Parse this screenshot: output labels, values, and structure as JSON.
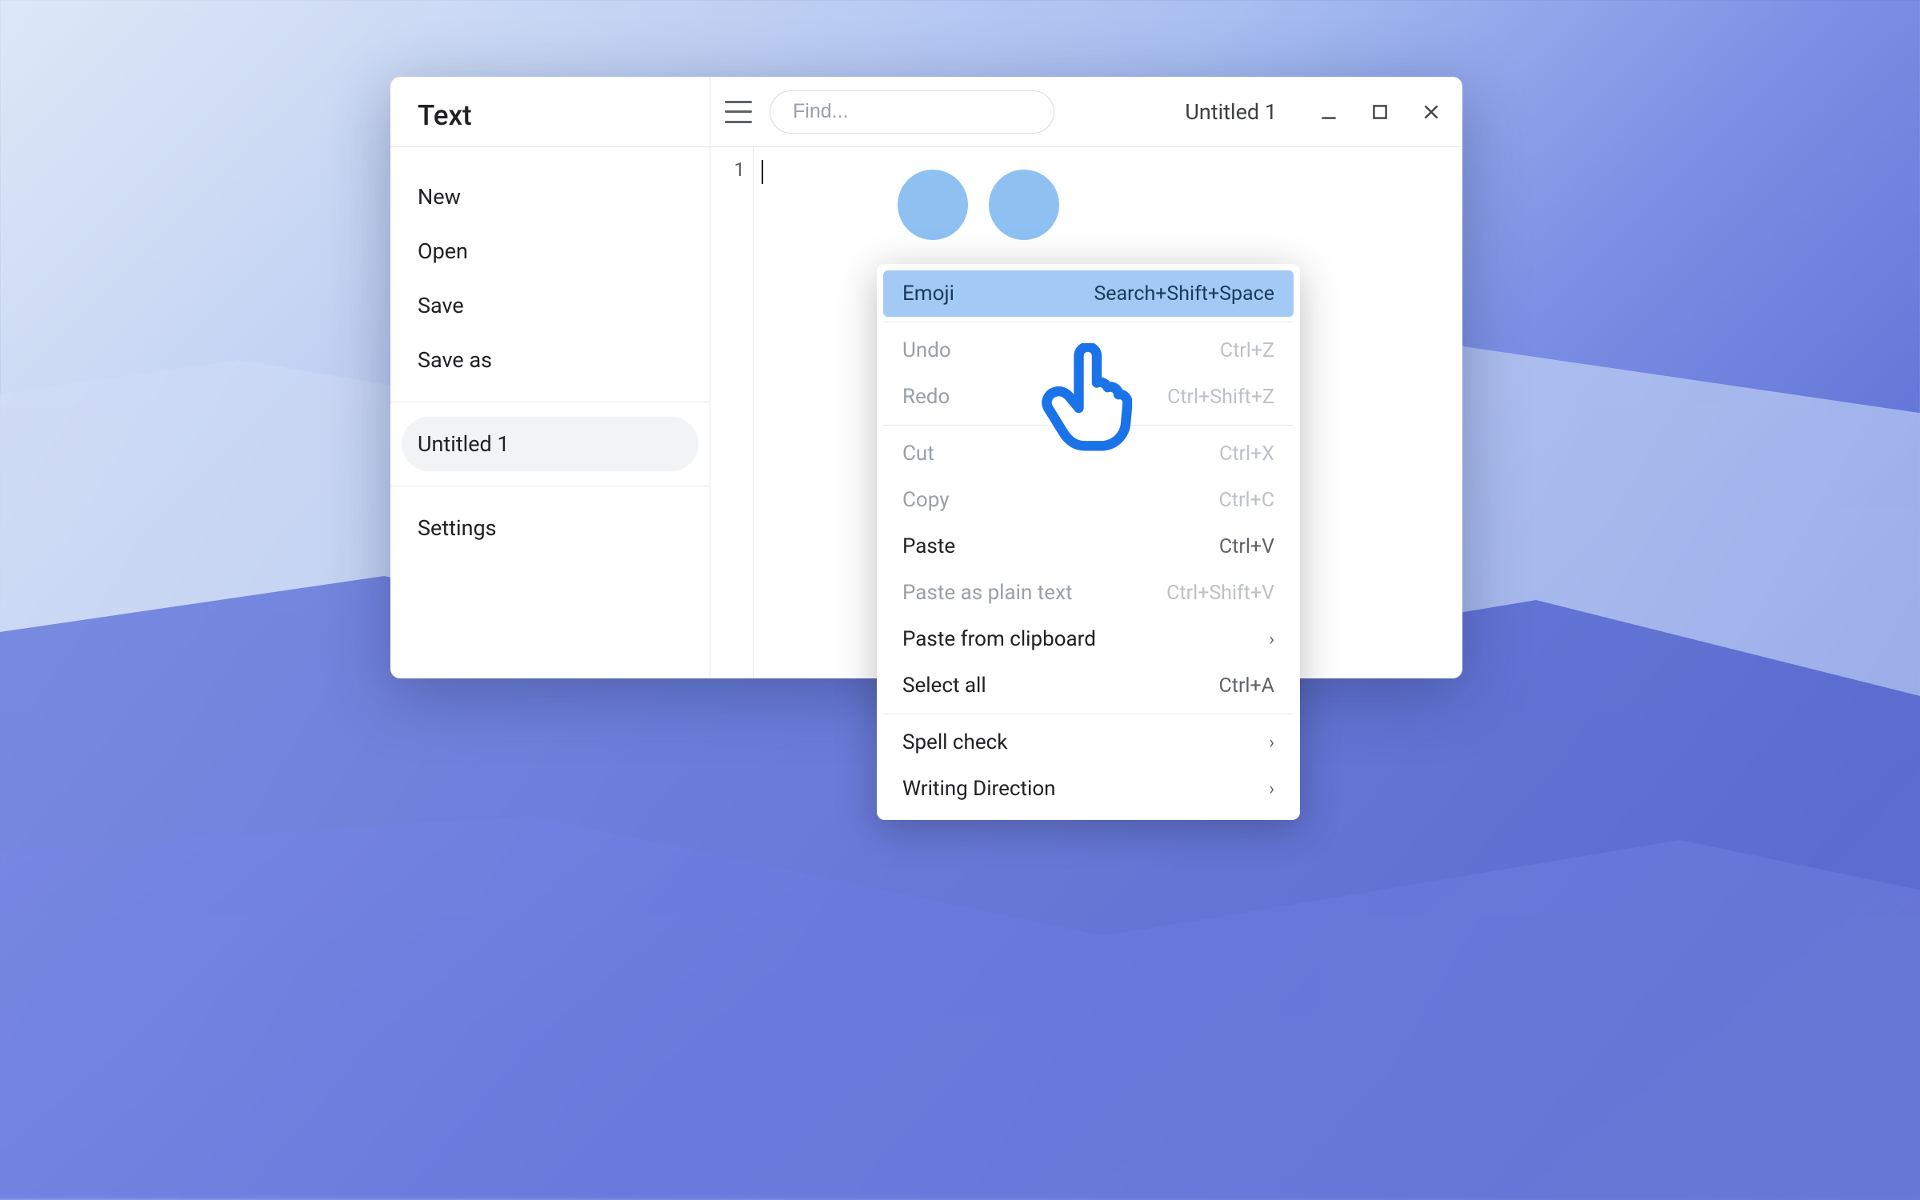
{
  "app": {
    "title": "Text"
  },
  "sidebar": {
    "items": [
      {
        "label": "New"
      },
      {
        "label": "Open"
      },
      {
        "label": "Save"
      },
      {
        "label": "Save as"
      }
    ],
    "activeDoc": "Untitled 1",
    "settings": "Settings"
  },
  "toolbar": {
    "search_placeholder": "Find...",
    "doc_name": "Untitled 1"
  },
  "editor": {
    "line_number": "1"
  },
  "context_menu": {
    "items": [
      {
        "label": "Emoji",
        "shortcut": "Search+Shift+Space",
        "state": "highlight",
        "arrow": false
      },
      {
        "sep": true
      },
      {
        "label": "Undo",
        "shortcut": "Ctrl+Z",
        "state": "disabled",
        "arrow": false
      },
      {
        "label": "Redo",
        "shortcut": "Ctrl+Shift+Z",
        "state": "disabled",
        "arrow": false
      },
      {
        "sep": true
      },
      {
        "label": "Cut",
        "shortcut": "Ctrl+X",
        "state": "disabled",
        "arrow": false
      },
      {
        "label": "Copy",
        "shortcut": "Ctrl+C",
        "state": "disabled",
        "arrow": false
      },
      {
        "label": "Paste",
        "shortcut": "Ctrl+V",
        "state": "normal",
        "arrow": false
      },
      {
        "label": "Paste as plain text",
        "shortcut": "Ctrl+Shift+V",
        "state": "disabled",
        "arrow": false
      },
      {
        "label": "Paste from clipboard",
        "shortcut": "",
        "state": "normal",
        "arrow": true
      },
      {
        "label": "Select all",
        "shortcut": "Ctrl+A",
        "state": "normal",
        "arrow": false
      },
      {
        "sep": true
      },
      {
        "label": "Spell check",
        "shortcut": "",
        "state": "normal",
        "arrow": true
      },
      {
        "label": "Writing Direction",
        "shortcut": "",
        "state": "normal",
        "arrow": true
      }
    ]
  }
}
